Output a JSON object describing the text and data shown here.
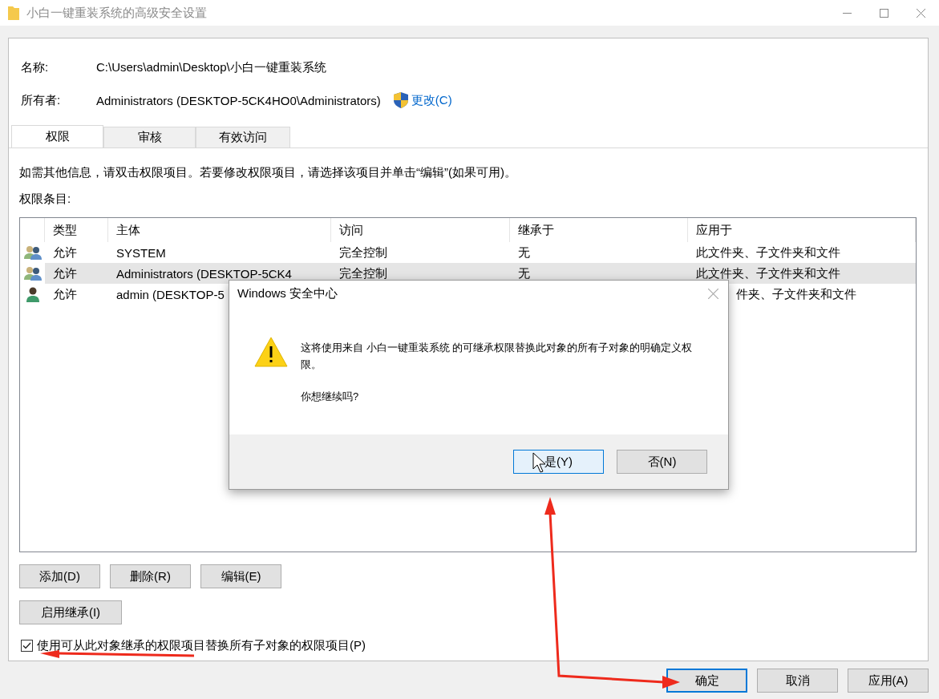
{
  "window": {
    "title": "小白一键重装系统的高级安全设置"
  },
  "fields": [
    {
      "label": "名称:",
      "value": "C:\\Users\\admin\\Desktop\\小白一键重装系统"
    },
    {
      "label": "所有者:",
      "value": "Administrators (DESKTOP-5CK4HO0\\Administrators)",
      "link": "更改(C)"
    }
  ],
  "tabs": [
    {
      "label": "权限",
      "selected": true
    },
    {
      "label": "审核",
      "selected": false
    },
    {
      "label": "有效访问",
      "selected": false
    }
  ],
  "info_text": "如需其他信息，请双击权限项目。若要修改权限项目，请选择该项目并单击“编辑”(如果可用)。",
  "entries_label": "权限条目:",
  "table": {
    "columns": [
      "类型",
      "主体",
      "访问",
      "继承于",
      "应用于"
    ],
    "rows": [
      {
        "kind": "group",
        "selected": false,
        "type": "允许",
        "principal": "SYSTEM",
        "access": "完全控制",
        "inherited_from": "无",
        "applies_to": "此文件夹、子文件夹和文件"
      },
      {
        "kind": "group",
        "selected": true,
        "type": "允许",
        "principal": "Administrators (DESKTOP-5CK4",
        "access": "完全控制",
        "inherited_from": "无",
        "applies_to": "此文件夹、子文件夹和文件"
      },
      {
        "kind": "user",
        "selected": false,
        "type": "允许",
        "principal": "admin (DESKTOP-5",
        "applies_to": "件夹、子文件夹和文件"
      }
    ]
  },
  "action_buttons": [
    "添加(D)",
    "删除(R)",
    "编辑(E)"
  ],
  "inherit_button": "启用继承(I)",
  "replace_checkbox": {
    "label": "使用可从此对象继承的权限项目替换所有子对象的权限项目(P)",
    "checked": true
  },
  "footer_buttons": [
    {
      "label": "确定",
      "default": true
    },
    {
      "label": "取消",
      "default": false
    },
    {
      "label": "应用(A)",
      "default": false
    }
  ],
  "dialog": {
    "title": "Windows 安全中心",
    "message": "这将使用来自 小白一键重装系统 的可继承权限替换此对象的所有子对象的明确定义权限。",
    "question": "你想继续吗?",
    "buttons": [
      {
        "label": "是(Y)",
        "default": true
      },
      {
        "label": "否(N)",
        "default": false
      }
    ]
  }
}
